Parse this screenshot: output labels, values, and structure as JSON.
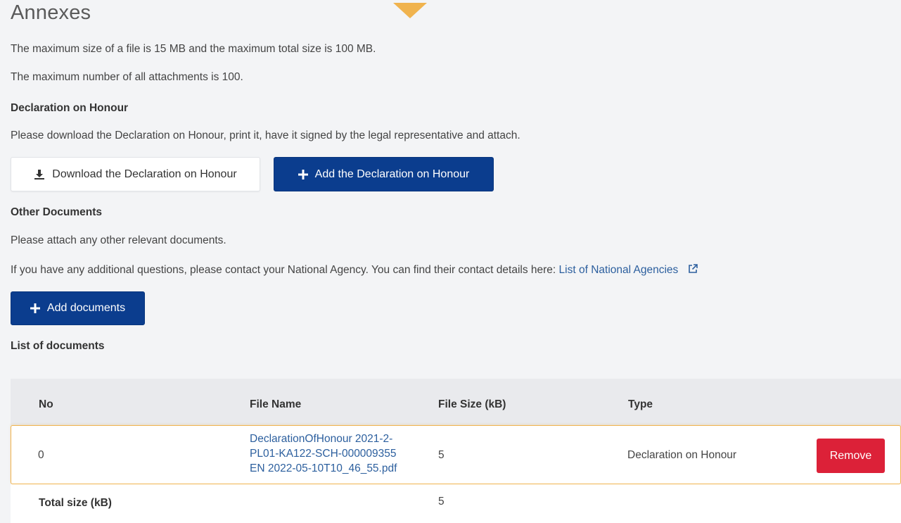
{
  "page": {
    "title": "Annexes",
    "max_size_text": "The maximum size of a file is 15 MB and the maximum total size is 100 MB.",
    "max_number_text": "The maximum number of all attachments is 100."
  },
  "declaration": {
    "heading": "Declaration on Honour",
    "instructions": "Please download the Declaration on Honour, print it, have it signed by the legal representative and attach.",
    "download_label": "Download the Declaration on Honour",
    "add_label": "Add the Declaration on Honour"
  },
  "other_documents": {
    "heading": "Other Documents",
    "instructions": "Please attach any other relevant documents.",
    "contact_text": "If you have any additional questions, please contact your National Agency. You can find their contact details here:",
    "contact_link": "List of National Agencies",
    "add_label": "Add documents"
  },
  "documents_list": {
    "heading": "List of documents",
    "columns": {
      "no": "No",
      "file_name": "File Name",
      "file_size": "File Size (kB)",
      "type": "Type"
    },
    "rows": [
      {
        "no": "0",
        "file_name_lines": [
          "DeclarationOfHonour 2021-2-",
          "PL01-KA122-SCH-000009355",
          "EN 2022-05-10T10_46_55.pdf"
        ],
        "file_size": "5",
        "type": "Declaration on Honour",
        "action_label": "Remove"
      }
    ],
    "total_label": "Total size (kB)",
    "total_value": "5"
  },
  "colors": {
    "primary": "#0b3d8e",
    "danger": "#dc2138",
    "accent": "#f0b34e",
    "link": "#2c5f9e"
  },
  "icons": {
    "download": "download-icon",
    "add": "plus-icon",
    "external": "external-link-icon"
  }
}
